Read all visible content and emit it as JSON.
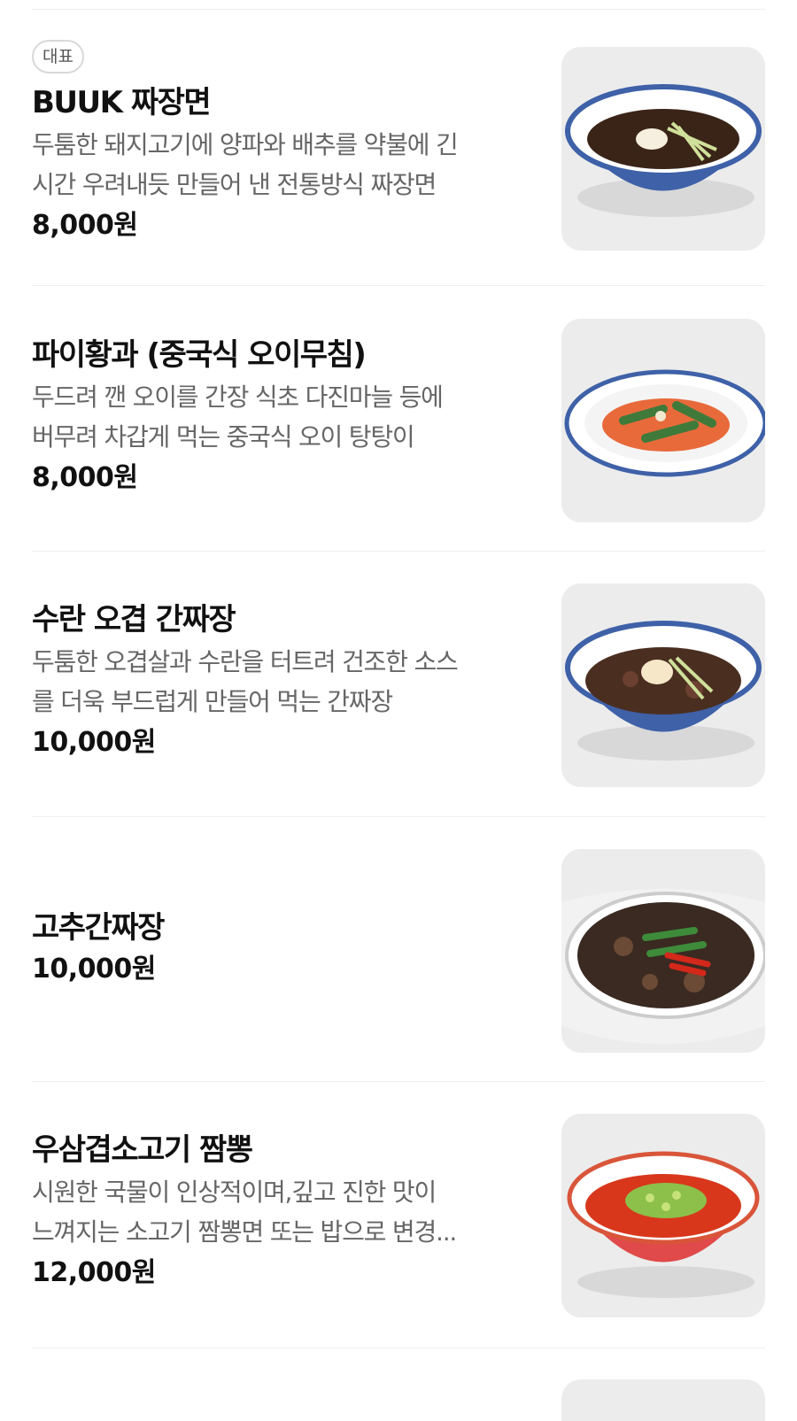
{
  "menu": {
    "items": [
      {
        "badge": "대표",
        "name": "BUUK 짜장면",
        "desc": [
          "두툼한 돼지고기에 양파와 배추를 약불에 긴",
          "시간 우려내듯 만들어 낸 전통방식 짜장면"
        ],
        "price": "8,000원",
        "image_icon": "jajangmyeon-bowl-image"
      },
      {
        "name": "파이황과 (중국식 오이무침)",
        "desc": [
          "두드려 깬 오이를 간장 식초 다진마늘 등에",
          "버무려 차갑게 먹는 중국식 오이 탕탕이"
        ],
        "price": "8,000원",
        "image_icon": "cucumber-salad-plate-image"
      },
      {
        "name": "수란 오겹 간짜장",
        "desc": [
          "두툼한 오겹살과 수란을 터트려 건조한 소스",
          "를 더욱 부드럽게 만들어 먹는 간짜장"
        ],
        "price": "10,000원",
        "image_icon": "ganjjajang-bowl-image"
      },
      {
        "name": "고추간짜장",
        "price": "10,000원",
        "image_icon": "pepper-ganjjajang-bowl-image"
      },
      {
        "name": "우삼겹소고기 짬뽕",
        "desc": [
          "시원한 국물이 인상적이며,깊고 진한 맛이",
          "느껴지는 소고기 짬뽕면 또는 밥으로 변경..."
        ],
        "price": "12,000원",
        "image_icon": "jjamppong-bowl-image"
      }
    ]
  },
  "colors": {
    "text_primary": "#111111",
    "text_secondary": "#666666",
    "divider": "#eeeeee",
    "badge_border": "#d8d8d8"
  }
}
